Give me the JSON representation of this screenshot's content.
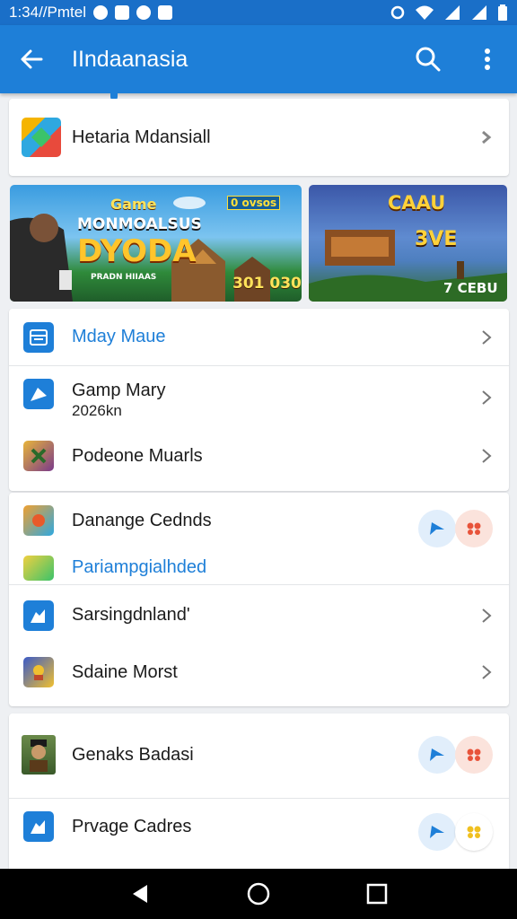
{
  "status_bar": {
    "time": "1:34//Pmtel"
  },
  "app_bar": {
    "title": "IIndaanasia"
  },
  "top_item": {
    "label": "Hetaria Mdansiall"
  },
  "banners": {
    "left": {
      "tag": "Game",
      "badge": "0 ovsos",
      "title_line1": "MONMOALSUS",
      "title_line2": "DYODA",
      "caption": "PRADN HIIAAS",
      "score": "301 030"
    },
    "right": {
      "title": "CAAU",
      "subtitle": "3VE",
      "price": "7 CEBU"
    }
  },
  "menu_section": {
    "items": [
      {
        "label": "Mday Maue",
        "highlight": true
      },
      {
        "label": "Gamp Mary",
        "sub": "2026kn"
      },
      {
        "label": "Podeone Muarls"
      }
    ]
  },
  "featured_section": {
    "items": [
      {
        "label": "Danange Cednds"
      },
      {
        "label": "Pariampgialhded",
        "highlight": true
      },
      {
        "label": "Sarsingdnland'"
      },
      {
        "label": "Sdaine Morst"
      }
    ]
  },
  "bottom_section": {
    "items": [
      {
        "label": "Genaks Badasi"
      },
      {
        "label": "Prvage Cadres"
      }
    ]
  },
  "colors": {
    "primary": "#1e7fd8",
    "status_bar": "#1a6fc8",
    "background": "#eef0f3"
  },
  "icons": [
    "back-arrow-icon",
    "search-icon",
    "more-vert-icon",
    "chevron-right-icon",
    "share-icon",
    "heart-icon",
    "nav-back-icon",
    "nav-home-icon",
    "nav-recents-icon"
  ]
}
